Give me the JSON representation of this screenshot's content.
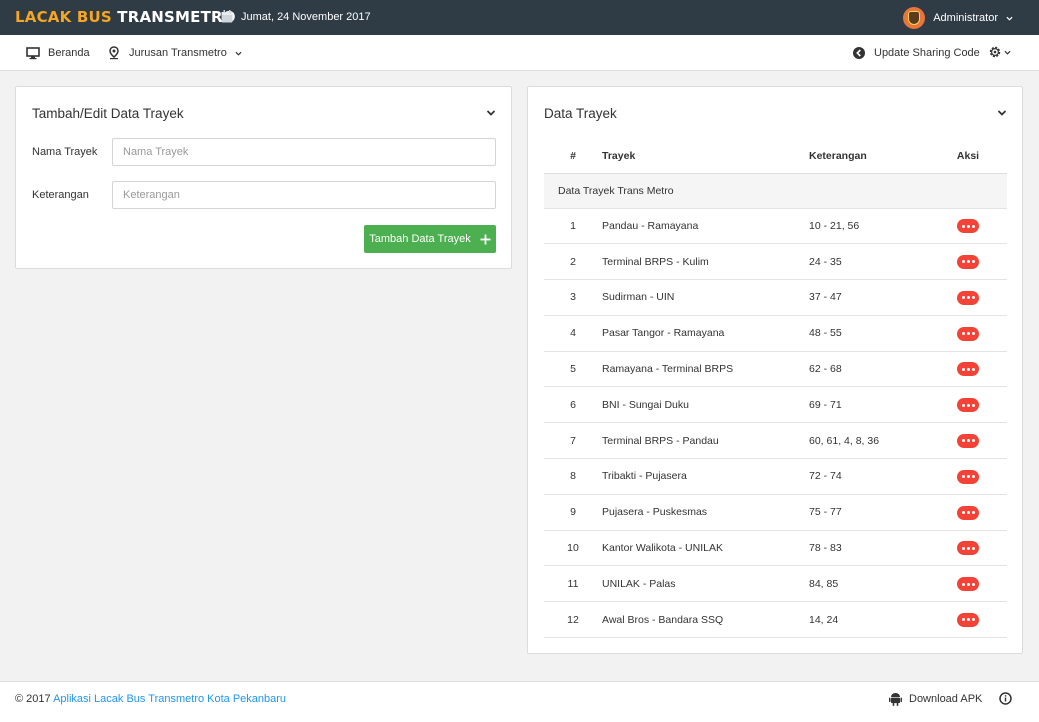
{
  "header": {
    "brand_part1": "LACAK BUS",
    "brand_part2": "TRANSMETRO",
    "date": "Jumat, 24 November 2017",
    "user": "Administrator"
  },
  "nav": {
    "beranda": "Beranda",
    "jurusan": "Jurusan Transmetro",
    "update": "Update Sharing Code"
  },
  "form": {
    "title": "Tambah/Edit Data Trayek",
    "nama_label": "Nama Trayek",
    "nama_placeholder": "Nama Trayek",
    "nama_value": "",
    "ket_label": "Keterangan",
    "ket_placeholder": "Keterangan",
    "ket_value": "",
    "submit_label": "Tambah Data Trayek"
  },
  "table": {
    "title": "Data Trayek",
    "headers": {
      "no": "#",
      "trayek": "Trayek",
      "keterangan": "Keterangan",
      "aksi": "Aksi"
    },
    "group_label": "Data Trayek Trans Metro",
    "rows": [
      {
        "no": "1",
        "trayek": "Pandau - Ramayana",
        "keterangan": "10 - 21, 56"
      },
      {
        "no": "2",
        "trayek": "Terminal BRPS - Kulim",
        "keterangan": "24 - 35"
      },
      {
        "no": "3",
        "trayek": "Sudirman - UIN",
        "keterangan": "37 - 47"
      },
      {
        "no": "4",
        "trayek": "Pasar Tangor - Ramayana",
        "keterangan": "48 - 55"
      },
      {
        "no": "5",
        "trayek": "Ramayana - Terminal BRPS",
        "keterangan": "62 - 68"
      },
      {
        "no": "6",
        "trayek": "BNI - Sungai Duku",
        "keterangan": "69 - 71"
      },
      {
        "no": "7",
        "trayek": "Terminal BRPS - Pandau",
        "keterangan": "60, 61, 4, 8, 36"
      },
      {
        "no": "8",
        "trayek": "Tribakti - Pujasera",
        "keterangan": "72 - 74"
      },
      {
        "no": "9",
        "trayek": "Pujasera - Puskesmas",
        "keterangan": "75 - 77"
      },
      {
        "no": "10",
        "trayek": "Kantor Walikota - UNILAK",
        "keterangan": "78 - 83"
      },
      {
        "no": "11",
        "trayek": "UNILAK - Palas",
        "keterangan": "84, 85"
      },
      {
        "no": "12",
        "trayek": "Awal Bros - Bandara SSQ",
        "keterangan": "14, 24"
      }
    ]
  },
  "footer": {
    "copyright": "© 2017",
    "link_text": "Aplikasi Lacak Bus Transmetro Kota Pekanbaru",
    "download": "Download APK"
  },
  "colors": {
    "header_bg": "#2f3b45",
    "brand_accent": "#f5a623",
    "button_green": "#4caf50",
    "action_red": "#f44336",
    "link_blue": "#2196f3"
  }
}
